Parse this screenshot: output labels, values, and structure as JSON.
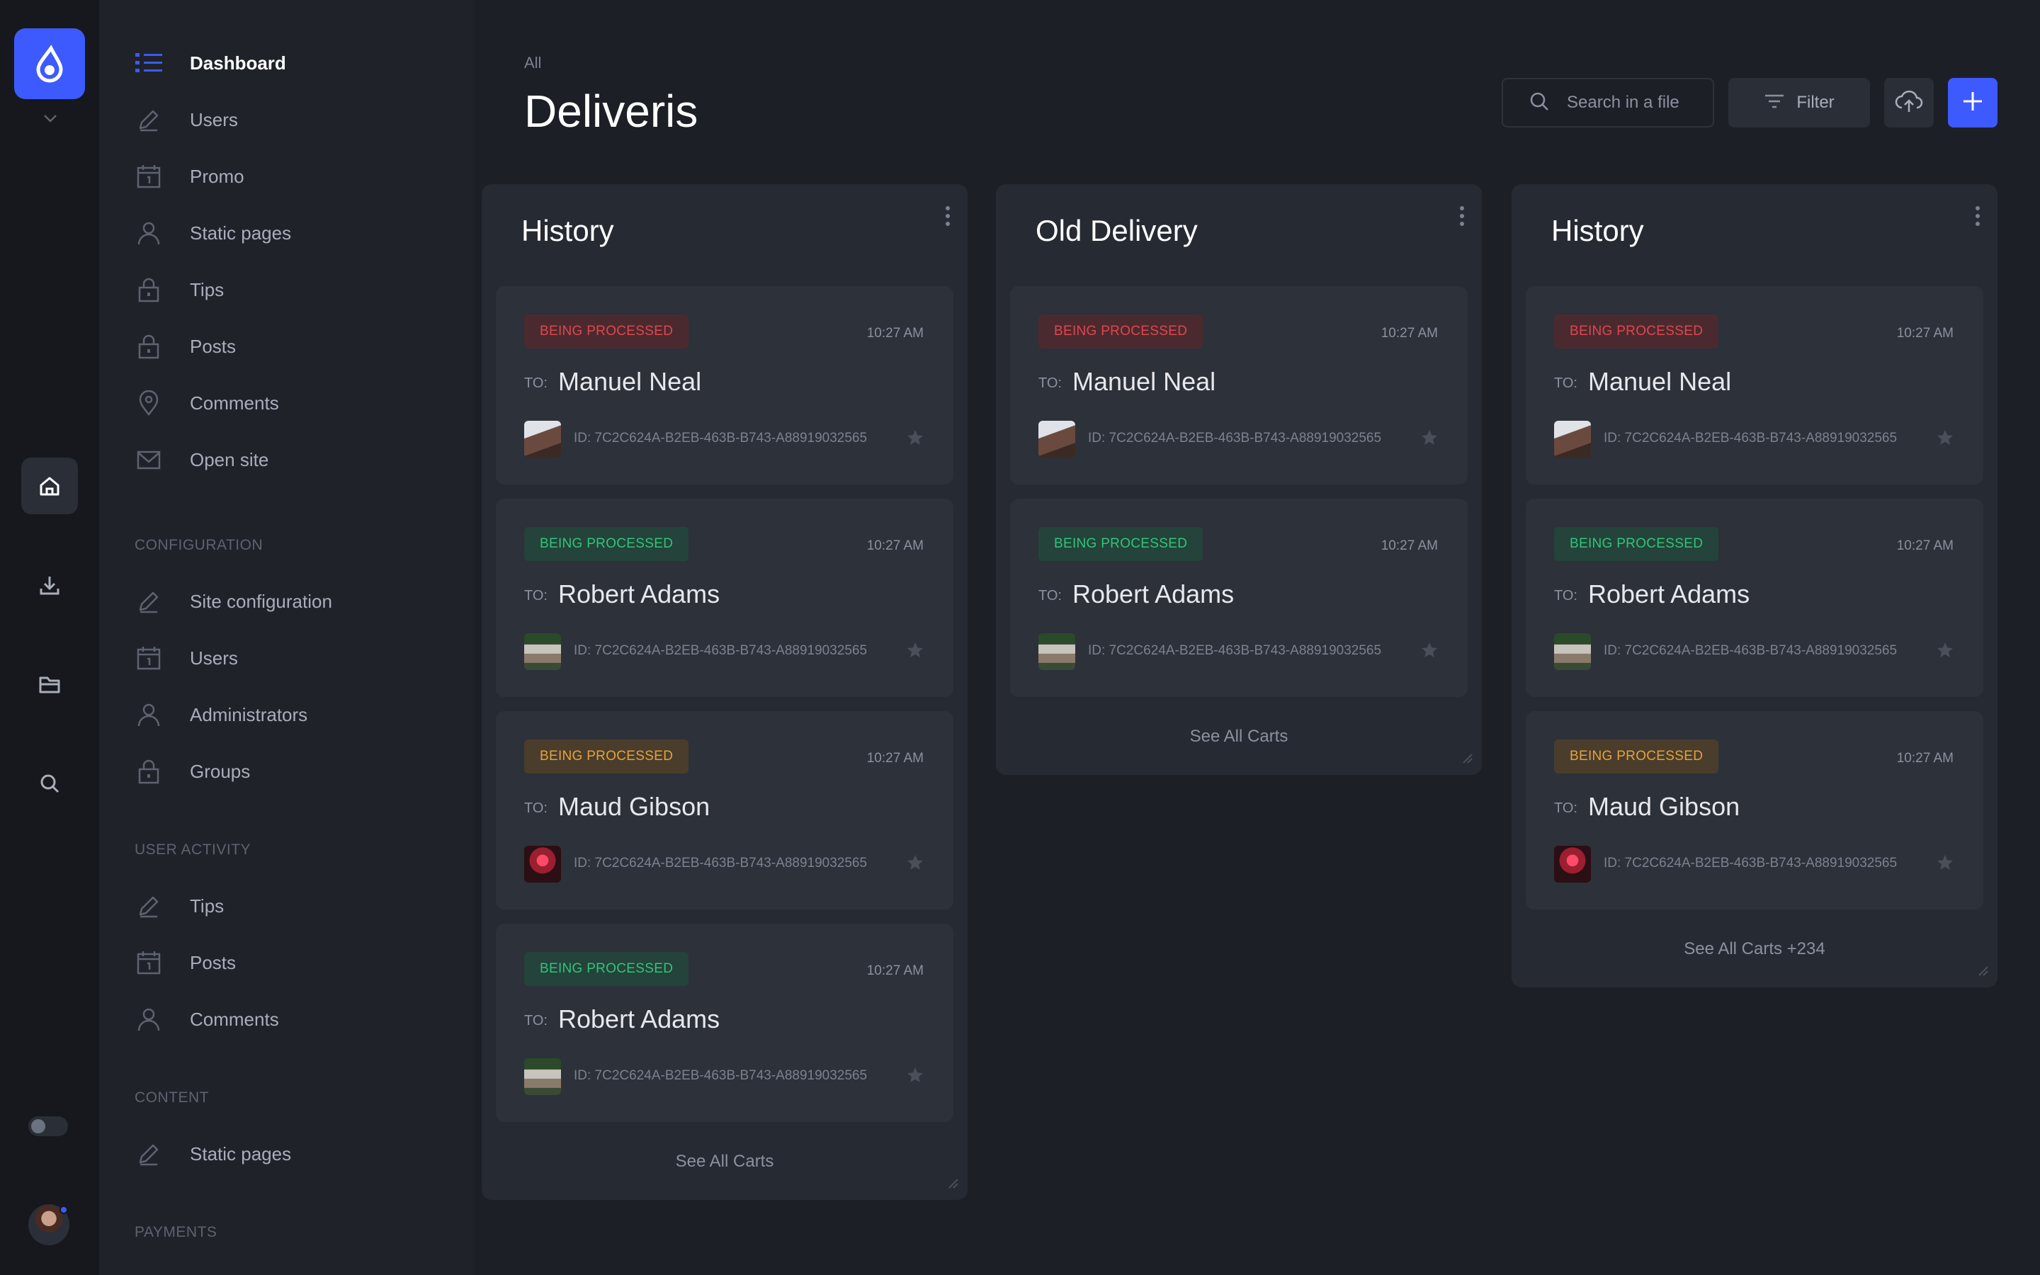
{
  "rail": {
    "logo_icon": "droplet-icon",
    "buttons": [
      "home-icon",
      "download-icon",
      "folder-icon",
      "search-icon"
    ],
    "theme_toggle": "off",
    "brand_color": "#3d5afe"
  },
  "sidebar": {
    "main": [
      {
        "label": "Dashboard",
        "icon": "list-icon",
        "active": true
      },
      {
        "label": "Users",
        "icon": "pencil-icon"
      },
      {
        "label": "Promo",
        "icon": "calendar-icon"
      },
      {
        "label": "Static pages",
        "icon": "user-icon"
      },
      {
        "label": "Tips",
        "icon": "lock-icon"
      },
      {
        "label": "Posts",
        "icon": "lock-icon"
      },
      {
        "label": "Comments",
        "icon": "location-icon"
      },
      {
        "label": "Open site",
        "icon": "mail-icon"
      }
    ],
    "configuration": {
      "title": "CONFIGURATION",
      "items": [
        {
          "label": "Site configuration",
          "icon": "pencil-icon"
        },
        {
          "label": "Users",
          "icon": "calendar-icon"
        },
        {
          "label": "Administrators",
          "icon": "user-icon"
        },
        {
          "label": "Groups",
          "icon": "lock-icon"
        }
      ]
    },
    "user_activity": {
      "title": "USER ACTIVITY",
      "items": [
        {
          "label": "Tips",
          "icon": "pencil-icon"
        },
        {
          "label": "Posts",
          "icon": "calendar-icon"
        },
        {
          "label": "Comments",
          "icon": "user-icon"
        }
      ]
    },
    "content": {
      "title": "CONTENT",
      "items": [
        {
          "label": "Static pages",
          "icon": "pencil-icon"
        }
      ]
    },
    "payments": {
      "title": "PAYMENTS"
    }
  },
  "header": {
    "breadcrumb": "All",
    "title": "Deliveris",
    "search_placeholder": "Search in a file",
    "filter_label": "Filter"
  },
  "columns": [
    {
      "title": "History",
      "footer": "See All Carts",
      "cards": [
        {
          "status": "BEING PROCESSED",
          "status_color": "red",
          "time": "10:27 AM",
          "to": "TO:",
          "name": "Manuel Neal",
          "id": "ID: 7C2C624A-B2EB-463B-B743-A88919032565",
          "thumb": "t1"
        },
        {
          "status": "BEING PROCESSED",
          "status_color": "green",
          "time": "10:27 AM",
          "to": "TO:",
          "name": "Robert Adams",
          "id": "ID: 7C2C624A-B2EB-463B-B743-A88919032565",
          "thumb": "t2"
        },
        {
          "status": "BEING PROCESSED",
          "status_color": "orange",
          "time": "10:27 AM",
          "to": "TO:",
          "name": "Maud Gibson",
          "id": "ID: 7C2C624A-B2EB-463B-B743-A88919032565",
          "thumb": "t3"
        },
        {
          "status": "BEING PROCESSED",
          "status_color": "green",
          "time": "10:27 AM",
          "to": "TO:",
          "name": "Robert Adams",
          "id": "ID: 7C2C624A-B2EB-463B-B743-A88919032565",
          "thumb": "t2"
        }
      ]
    },
    {
      "title": "Old Delivery",
      "footer": "See All Carts",
      "cards": [
        {
          "status": "BEING PROCESSED",
          "status_color": "red",
          "time": "10:27 AM",
          "to": "TO:",
          "name": "Manuel Neal",
          "id": "ID: 7C2C624A-B2EB-463B-B743-A88919032565",
          "thumb": "t1"
        },
        {
          "status": "BEING PROCESSED",
          "status_color": "green",
          "time": "10:27 AM",
          "to": "TO:",
          "name": "Robert Adams",
          "id": "ID: 7C2C624A-B2EB-463B-B743-A88919032565",
          "thumb": "t2"
        }
      ]
    },
    {
      "title": "History",
      "footer": "See All Carts +234",
      "cards": [
        {
          "status": "BEING PROCESSED",
          "status_color": "red",
          "time": "10:27 AM",
          "to": "TO:",
          "name": "Manuel Neal",
          "id": "ID: 7C2C624A-B2EB-463B-B743-A88919032565",
          "thumb": "t1"
        },
        {
          "status": "BEING PROCESSED",
          "status_color": "green",
          "time": "10:27 AM",
          "to": "TO:",
          "name": "Robert Adams",
          "id": "ID: 7C2C624A-B2EB-463B-B743-A88919032565",
          "thumb": "t2"
        },
        {
          "status": "BEING PROCESSED",
          "status_color": "orange",
          "time": "10:27 AM",
          "to": "TO:",
          "name": "Maud Gibson",
          "id": "ID: 7C2C624A-B2EB-463B-B743-A88919032565",
          "thumb": "t3"
        }
      ]
    }
  ]
}
